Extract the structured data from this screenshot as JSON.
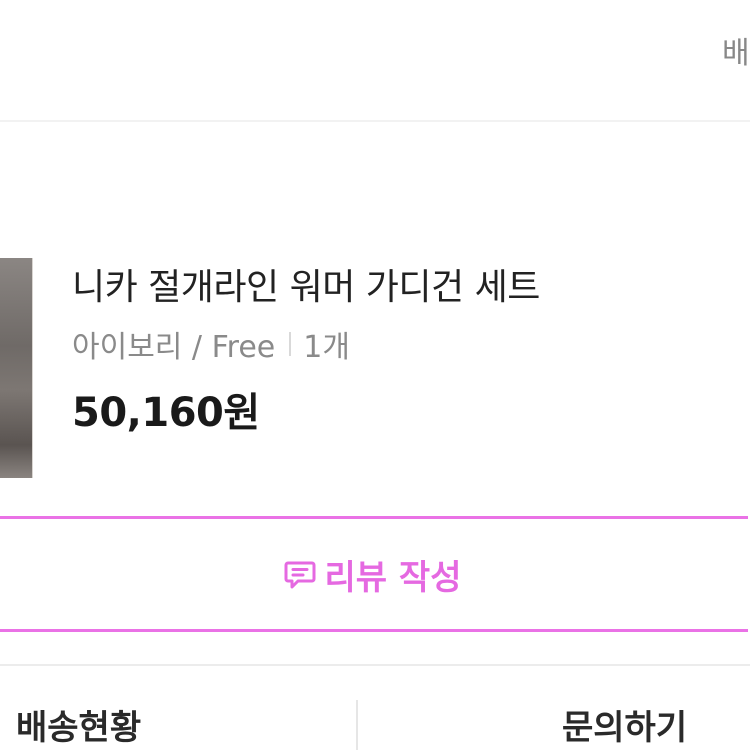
{
  "header": {
    "right_text": "배"
  },
  "product": {
    "name": "니카 절개라인 워머 가디건 세트",
    "option": "아이보리 / Free",
    "quantity": "1개",
    "price": "50,160원"
  },
  "review_button": {
    "icon": "chat-bubble-icon",
    "label": "리뷰 작성",
    "color": "#e569e1"
  },
  "bottom_actions": {
    "left_label": "배송현황",
    "right_label": "문의하기"
  }
}
